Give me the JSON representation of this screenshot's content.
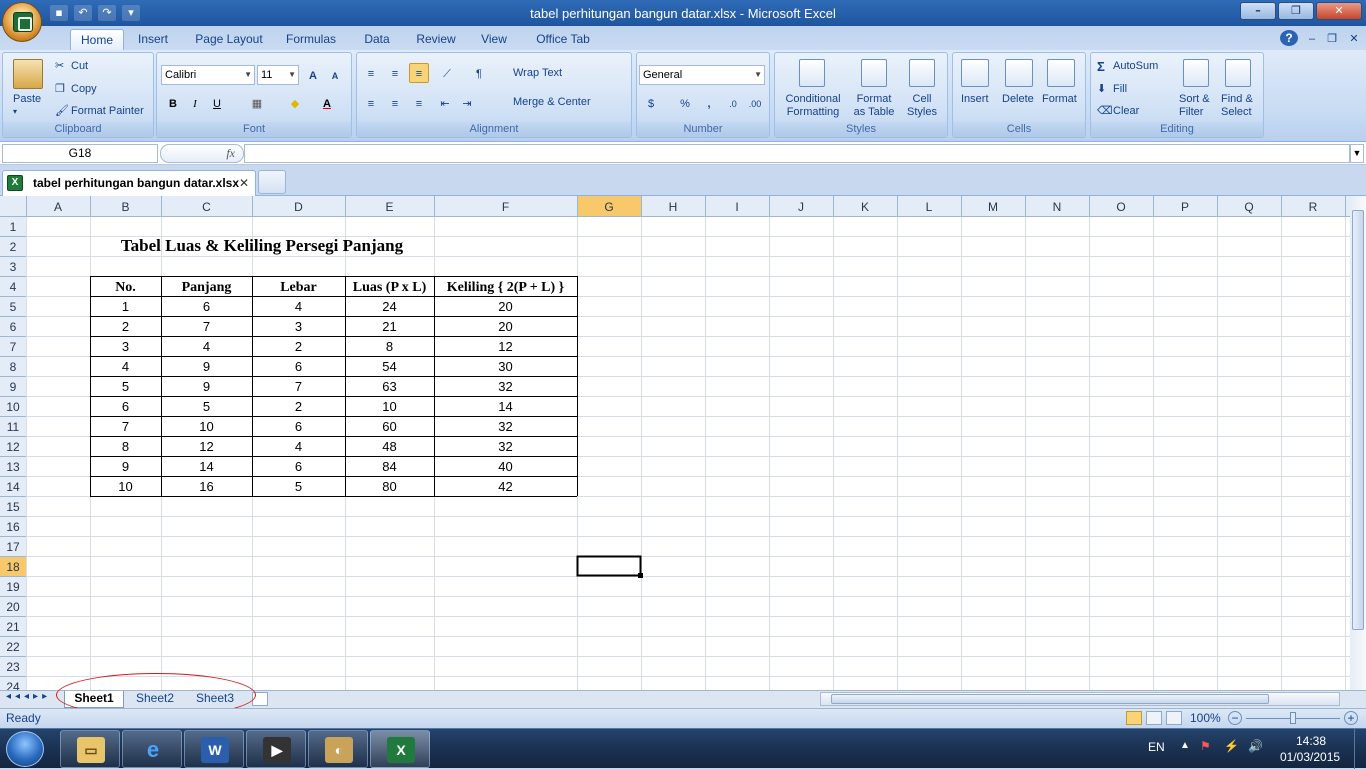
{
  "window": {
    "title": "tabel perhitungan bangun datar.xlsx - Microsoft Excel"
  },
  "ribbon": {
    "tabs": [
      "Home",
      "Insert",
      "Page Layout",
      "Formulas",
      "Data",
      "Review",
      "View",
      "Office Tab"
    ],
    "clipboard": {
      "paste": "Paste",
      "cut": "Cut",
      "copy": "Copy",
      "format_painter": "Format Painter",
      "label": "Clipboard"
    },
    "font": {
      "name": "Calibri",
      "size": "11",
      "bold": "B",
      "italic": "I",
      "underline": "U",
      "label": "Font"
    },
    "alignment": {
      "wrap": "Wrap Text",
      "merge": "Merge & Center",
      "label": "Alignment"
    },
    "number": {
      "format": "General",
      "percent": "%",
      "comma": ",",
      "label": "Number"
    },
    "styles": {
      "conditional1": "Conditional",
      "conditional2": "Formatting",
      "format_table1": "Format",
      "format_table2": "as Table",
      "cell_styles1": "Cell",
      "cell_styles2": "Styles",
      "label": "Styles"
    },
    "cells": {
      "insert": "Insert",
      "delete": "Delete",
      "format": "Format",
      "label": "Cells"
    },
    "editing": {
      "autosum": "AutoSum",
      "fill": "Fill",
      "clear": "Clear",
      "sort1": "Sort &",
      "sort2": "Filter",
      "find1": "Find &",
      "find2": "Select",
      "label": "Editing"
    }
  },
  "formula_bar": {
    "name_box": "G18",
    "fx": "fx",
    "value": ""
  },
  "doc_tab": {
    "name": "tabel perhitungan bangun datar.xlsx"
  },
  "sheet": {
    "columns": [
      "A",
      "B",
      "C",
      "D",
      "E",
      "F",
      "G",
      "H",
      "I",
      "J",
      "K",
      "L",
      "M",
      "N",
      "O",
      "P",
      "Q",
      "R"
    ],
    "rows": [
      "1",
      "2",
      "3",
      "4",
      "5",
      "6",
      "7",
      "8",
      "9",
      "10",
      "11",
      "12",
      "13",
      "14",
      "15",
      "16",
      "17",
      "18",
      "19",
      "20",
      "21",
      "22",
      "23",
      "24"
    ],
    "selected_cell": "G18",
    "table": {
      "title": "Tabel Luas & Keliling Persegi Panjang",
      "headers": [
        "No.",
        "Panjang",
        "Lebar",
        "Luas (P x L)",
        "Keliling { 2(P + L) }"
      ],
      "rows": [
        [
          "1",
          "6",
          "4",
          "24",
          "20"
        ],
        [
          "2",
          "7",
          "3",
          "21",
          "20"
        ],
        [
          "3",
          "4",
          "2",
          "8",
          "12"
        ],
        [
          "4",
          "9",
          "6",
          "54",
          "30"
        ],
        [
          "5",
          "9",
          "7",
          "63",
          "32"
        ],
        [
          "6",
          "5",
          "2",
          "10",
          "14"
        ],
        [
          "7",
          "10",
          "6",
          "60",
          "32"
        ],
        [
          "8",
          "12",
          "4",
          "48",
          "32"
        ],
        [
          "9",
          "14",
          "6",
          "84",
          "40"
        ],
        [
          "10",
          "16",
          "5",
          "80",
          "42"
        ]
      ]
    }
  },
  "sheet_tabs": [
    "Sheet1",
    "Sheet2",
    "Sheet3"
  ],
  "status": {
    "ready": "Ready",
    "zoom": "100%"
  },
  "taskbar": {
    "lang": "EN",
    "time": "14:38",
    "date": "01/03/2015"
  }
}
